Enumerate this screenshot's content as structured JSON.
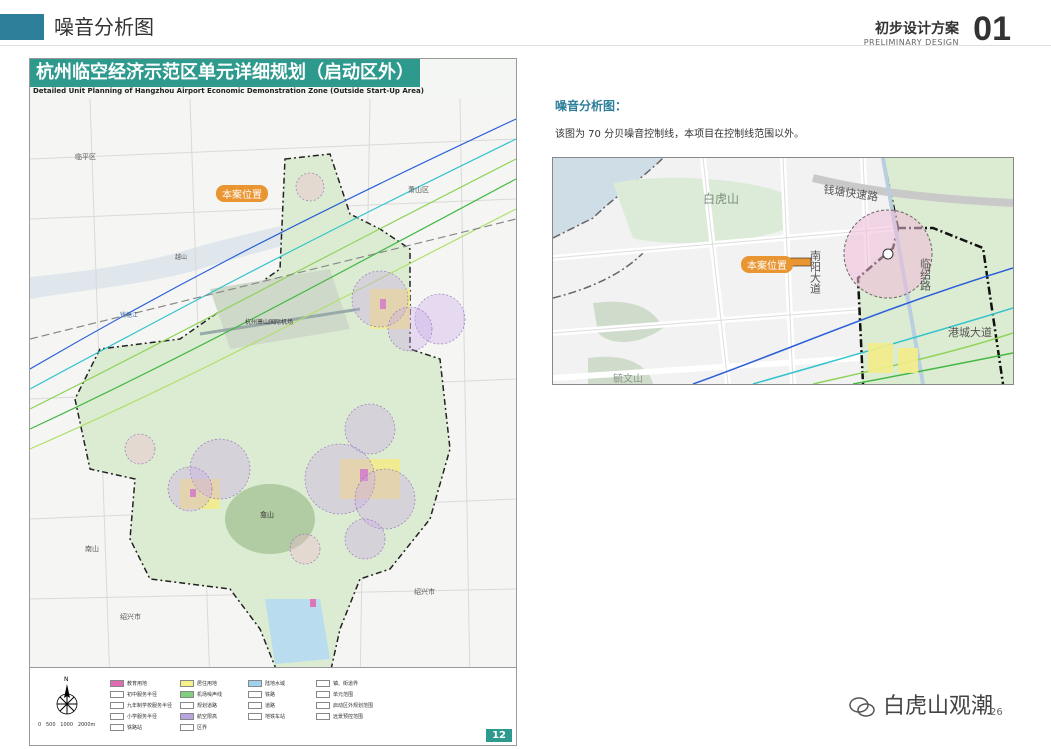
{
  "header": {
    "section_title": "噪音分析图",
    "scheme_cn": "初步设计方案",
    "scheme_en": "PRELIMINARY DESIGN",
    "section_number": "01"
  },
  "plan": {
    "title": "杭州临空经济示范区单元详细规划（启动区外）",
    "subtitle": "Detailed Unit Planning of Hangzhou Airport Economic Demonstration Zone (Outside Start-Up Area)",
    "callout": "本案位置",
    "page": "12",
    "places": {
      "linping": "临平区",
      "xiaoshan_west": "萧山区",
      "airport": "杭州萧山国际机场",
      "kanshan": "龛山",
      "nanshan": "南山",
      "yueshan": "越山",
      "qiantang": "钱塘江",
      "shaoxing_w": "绍兴市",
      "shaoxing_e": "绍兴市"
    },
    "legend": [
      {
        "label": "教育用地",
        "color": "#e06bb0"
      },
      {
        "label": "居住用地",
        "color": "#f6f08a"
      },
      {
        "label": "陆地水域",
        "color": "#9ed2ef"
      },
      {
        "label": "镇、街道界",
        "color": "#ffffff"
      },
      {
        "label": "初中服务半径",
        "color": "#ffffff"
      },
      {
        "label": "机场噪声线",
        "color": "#7ecf7e"
      },
      {
        "label": "铁路",
        "color": "#ffffff"
      },
      {
        "label": "单元范围",
        "color": "#ffffff"
      },
      {
        "label": "九年制学校服务半径",
        "color": "#ffffff"
      },
      {
        "label": "规划道路",
        "color": "#ffffff"
      },
      {
        "label": "道路",
        "color": "#ffffff"
      },
      {
        "label": "启动区外规划范围",
        "color": "#ffffff"
      },
      {
        "label": "小学服务半径",
        "color": "#ffffff"
      },
      {
        "label": "航空限高",
        "color": "#b8a4e0"
      },
      {
        "label": "地铁车站",
        "color": "#ffffff"
      },
      {
        "label": "远景预控范围",
        "color": "#ffffff"
      },
      {
        "label": "铁路站",
        "color": "#ffffff"
      },
      {
        "label": "区界",
        "color": "#ffffff"
      }
    ],
    "scale": {
      "a": "0",
      "b": "500",
      "c": "1000",
      "d": "2000m"
    },
    "north": "N"
  },
  "right": {
    "title": "噪音分析图：",
    "description": "该图为 70 分贝噪音控制线，本项目在控制线范围以外。"
  },
  "detail": {
    "callout": "本案位置",
    "baihushan": "白虎山",
    "qiantang_road": "钱塘快速路",
    "nanyang_road": "南阳大道",
    "linshao_road": "临绍路",
    "gangcheng_road": "港城大道",
    "heights": "毓文山"
  },
  "watermark": {
    "text": "白虎山观潮",
    "page_small": "26"
  },
  "colors": {
    "accent": "#2d7f99",
    "title_bg": "#2e9a8d",
    "callout": "#e89532",
    "green_zone": "#dcecd2"
  }
}
